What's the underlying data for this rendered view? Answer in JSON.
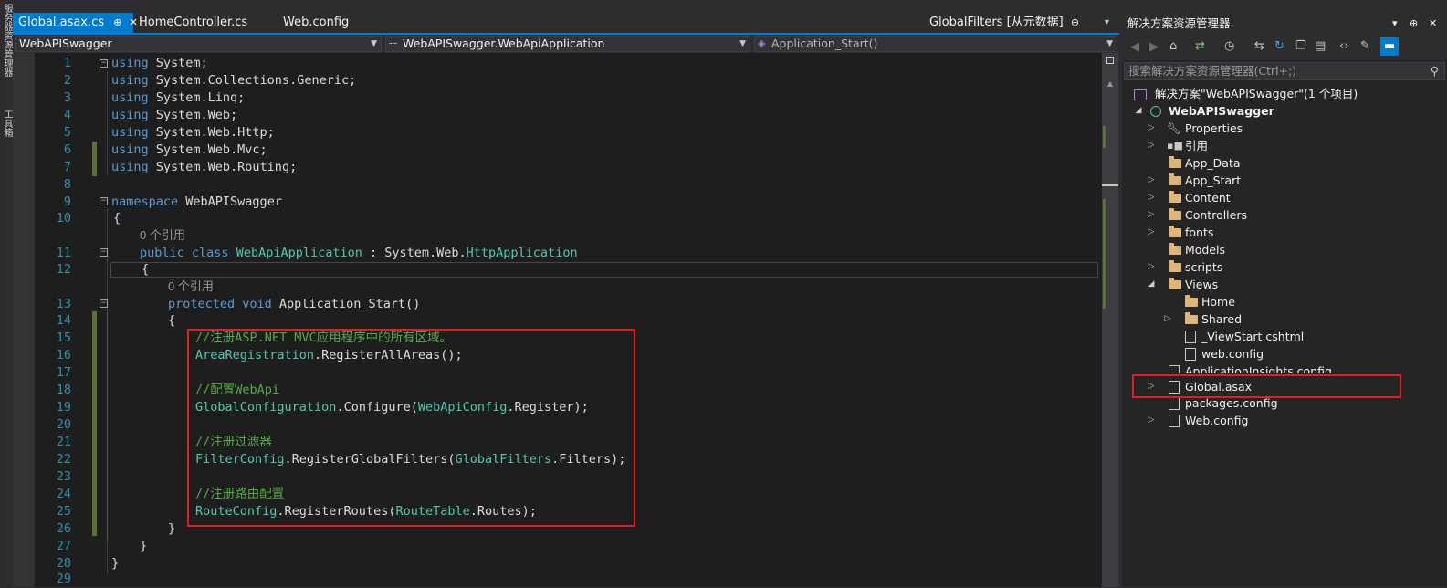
{
  "left_dock": {
    "items": [
      "服务器资源管理器",
      "工具箱"
    ]
  },
  "tabs": [
    {
      "label": "Global.asax.cs",
      "pin": "⊕",
      "close": "✕",
      "active": true
    },
    {
      "label": "HomeController.cs",
      "active": false
    },
    {
      "label": "Web.config",
      "active": false
    }
  ],
  "right_tab": {
    "label": "GlobalFilters [从元数据]",
    "pin": "⊕"
  },
  "tab_overflow": "▾",
  "navbar": {
    "project": "WebAPISwagger",
    "class": "WebAPISwagger.WebApiApplication",
    "member": "Application_Start()"
  },
  "editor": {
    "line_numbers": [
      "1",
      "2",
      "3",
      "4",
      "5",
      "6",
      "7",
      "8",
      "9",
      "10",
      "11",
      "12",
      "13",
      "14",
      "15",
      "16",
      "17",
      "18",
      "19",
      "20",
      "21",
      "22",
      "23",
      "24",
      "25",
      "26",
      "27",
      "28",
      "29"
    ],
    "code": {
      "l1_kw": "using",
      "l1_rest": " System;",
      "l2_kw": "using",
      "l2_rest": " System.Collections.Generic;",
      "l3_kw": "using",
      "l3_rest": " System.Linq;",
      "l4_kw": "using",
      "l4_rest": " System.Web;",
      "l5_kw": "using",
      "l5_rest": " System.Web.Http;",
      "l6_kw": "using",
      "l6_rest": " System.Web.Mvc;",
      "l7_kw": "using",
      "l7_rest": " System.Web.Routing;",
      "l9_kw": "namespace",
      "l9_rest": " WebAPISwagger",
      "l10": "{",
      "hint1": "0 个引用",
      "l11_kw": "public class",
      "l11_type": "WebApiApplication",
      "l11_mid": " : System.Web.",
      "l11_base": "HttpApplication",
      "l12": "{",
      "hint2": "0 个引用",
      "l13_kw": "protected void",
      "l13_rest": " Application_Start()",
      "l14": "{",
      "l15": "//注册ASP.NET MVC应用程序中的所有区域。",
      "l16_type": "AreaRegistration",
      "l16_rest": ".RegisterAllAreas();",
      "l18": "//配置WebApi",
      "l19_type": "GlobalConfiguration",
      "l19_mid": ".Configure(",
      "l19_type2": "WebApiConfig",
      "l19_rest": ".Register);",
      "l21": "//注册过滤器",
      "l22_type": "FilterConfig",
      "l22_mid": ".RegisterGlobalFilters(",
      "l22_type2": "GlobalFilters",
      "l22_rest": ".Filters);",
      "l24": "//注册路由配置",
      "l25_type": "RouteConfig",
      "l25_mid": ".RegisterRoutes(",
      "l25_type2": "RouteTable",
      "l25_rest": ".Routes);",
      "l26": "}",
      "l27": "}",
      "l28": "}"
    }
  },
  "solution_explorer": {
    "title": "解决方案资源管理器",
    "title_buttons": [
      "▾",
      "⊕",
      "✕"
    ],
    "search_placeholder": "搜索解决方案资源管理器(Ctrl+;)",
    "search_icon": "⚲",
    "solution": "解决方案\"WebAPISwagger\"(1 个项目)",
    "project": "WebAPISwagger",
    "items": [
      {
        "label": "Properties"
      },
      {
        "label": "引用"
      },
      {
        "label": "App_Data"
      },
      {
        "label": "App_Start"
      },
      {
        "label": "Content"
      },
      {
        "label": "Controllers"
      },
      {
        "label": "fonts"
      },
      {
        "label": "Models"
      },
      {
        "label": "scripts"
      },
      {
        "label": "Views"
      },
      {
        "label": "Home"
      },
      {
        "label": "Shared"
      },
      {
        "label": "_ViewStart.cshtml"
      },
      {
        "label": "web.config"
      },
      {
        "label": "ApplicationInsights.config"
      },
      {
        "label": "Global.asax"
      },
      {
        "label": "packages.config"
      },
      {
        "label": "Web.config"
      }
    ]
  },
  "colors": {
    "accent": "#007acc",
    "highlight_box": "#e02020",
    "keyword": "#569cd6",
    "type": "#4ec9b0",
    "comment": "#57a64a"
  }
}
